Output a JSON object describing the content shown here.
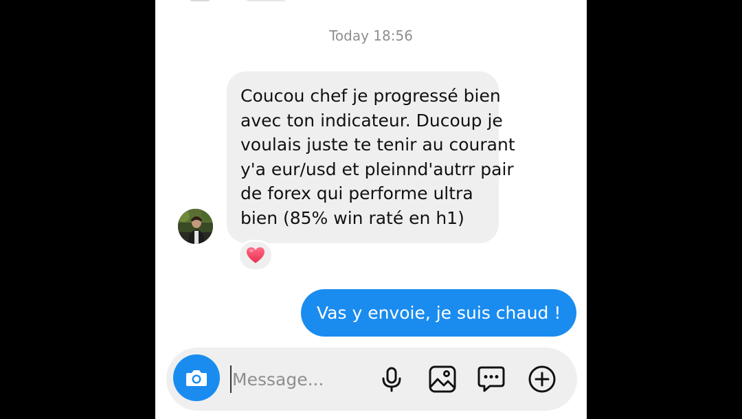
{
  "thread": {
    "timestamp": "Today 18:56",
    "incoming": {
      "lines": [
        "Coucou chef je progressé bien",
        "avec ton indicateur. Ducoup je",
        "voulais juste te tenir au courant",
        "y'a eur/usd et pleinnd'autrr pair",
        "de forex qui performe ultra",
        "bien (85% win raté en h1)"
      ],
      "reaction_icon": "heart-icon"
    },
    "outgoing": {
      "text": "Vas y envoie, je suis chaud !"
    }
  },
  "composer": {
    "placeholder": "Message...",
    "icons": [
      "camera-icon",
      "microphone-icon",
      "gallery-icon",
      "sticker-icon",
      "plus-icon"
    ]
  },
  "colors": {
    "accent": "#1a8cf0",
    "incoming_bubble": "#efefef",
    "reaction_heart": "#f0446a"
  }
}
